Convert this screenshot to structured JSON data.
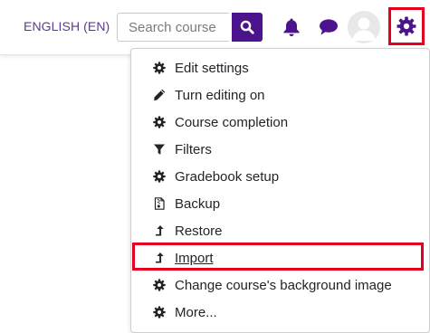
{
  "header": {
    "language_label": "ENGLISH (EN)",
    "search_placeholder": "Search course",
    "search_value": "",
    "icons": [
      "search-icon",
      "bell-icon",
      "chat-icon",
      "user-avatar",
      "gear-icon"
    ]
  },
  "colors": {
    "brand": "#4c148c",
    "language_text": "#5d3a8f",
    "highlight": "#e5001f"
  },
  "menu": {
    "items": [
      {
        "label": "Edit settings",
        "icon": "gear-icon"
      },
      {
        "label": "Turn editing on",
        "icon": "pencil-icon"
      },
      {
        "label": "Course completion",
        "icon": "gear-icon"
      },
      {
        "label": "Filters",
        "icon": "filter-icon"
      },
      {
        "label": "Gradebook setup",
        "icon": "gear-icon"
      },
      {
        "label": "Backup",
        "icon": "file-archive-icon"
      },
      {
        "label": "Restore",
        "icon": "level-up-icon"
      },
      {
        "label": "Import",
        "icon": "level-up-icon"
      },
      {
        "label": "Change course's background image",
        "icon": "gear-icon"
      },
      {
        "label": "More...",
        "icon": "gear-icon"
      }
    ]
  }
}
